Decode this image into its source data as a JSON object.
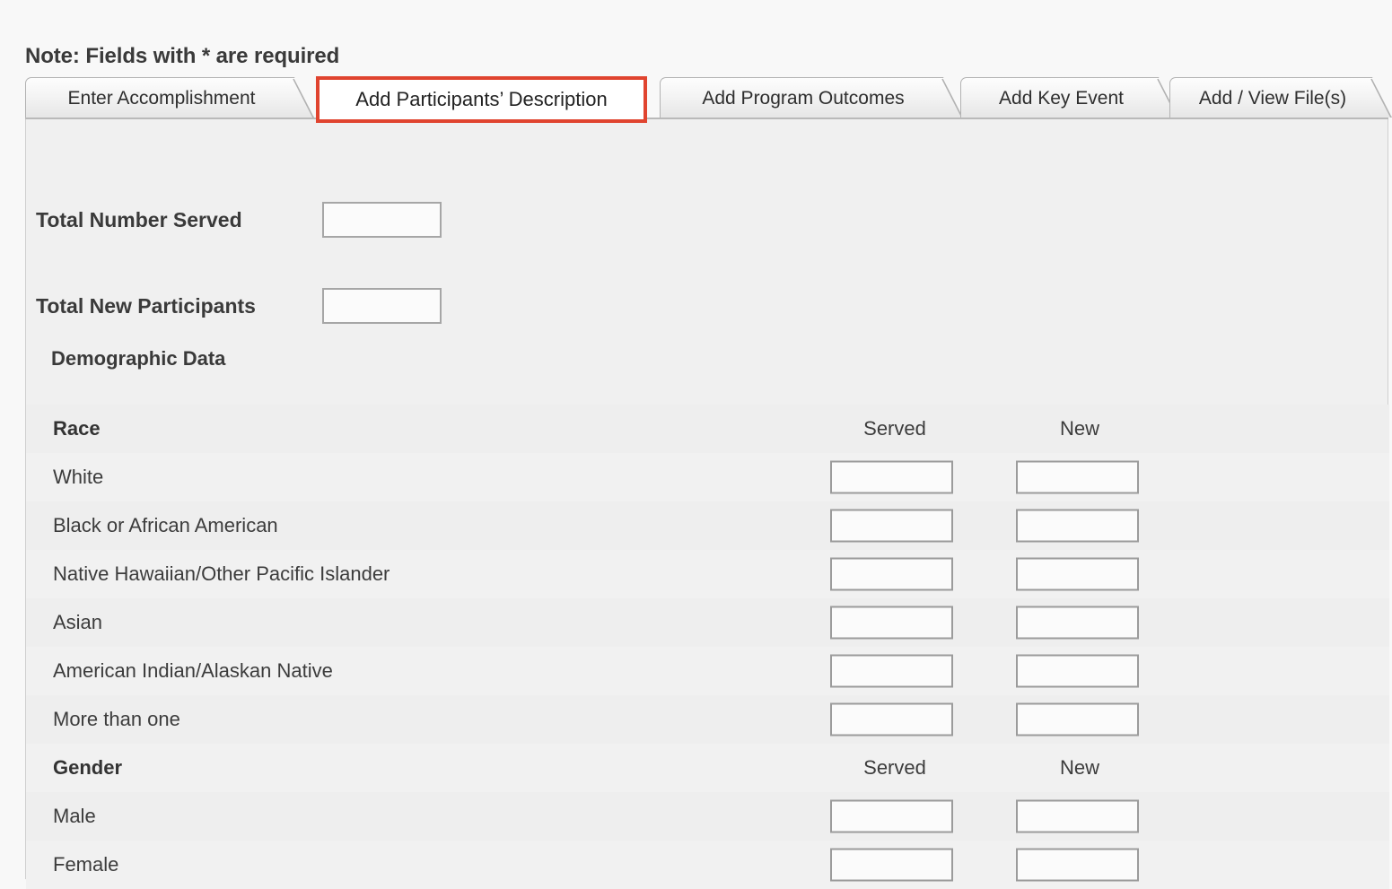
{
  "page": {
    "note": "Note: Fields with * are required",
    "background_color": "#f0f0f0",
    "accent_highlight_color": "#e0442f"
  },
  "tabs": [
    {
      "label": "Enter Accomplishment",
      "active": false
    },
    {
      "label": "Add Participants’ Description",
      "active": true
    },
    {
      "label": "Add Program Outcomes",
      "active": false
    },
    {
      "label": "Add Key Event",
      "active": false
    },
    {
      "label": "Add / View File(s)",
      "active": false
    }
  ],
  "form": {
    "total_number_served": {
      "label": "Total Number Served",
      "value": ""
    },
    "total_new_participants": {
      "label": "Total New Participants",
      "value": ""
    },
    "demographic_heading": "Demographic Data"
  },
  "columns": {
    "served": "Served",
    "new": "New"
  },
  "sections": [
    {
      "heading": "Race",
      "rows": [
        {
          "label": "White",
          "served": "",
          "new": ""
        },
        {
          "label": "Black or African American",
          "served": "",
          "new": ""
        },
        {
          "label": "Native Hawaiian/Other Pacific Islander",
          "served": "",
          "new": ""
        },
        {
          "label": "Asian",
          "served": "",
          "new": ""
        },
        {
          "label": "American Indian/Alaskan Native",
          "served": "",
          "new": ""
        },
        {
          "label": "More than one",
          "served": "",
          "new": ""
        }
      ]
    },
    {
      "heading": "Gender",
      "rows": [
        {
          "label": "Male",
          "served": "",
          "new": ""
        },
        {
          "label": "Female",
          "served": "",
          "new": ""
        }
      ]
    }
  ]
}
